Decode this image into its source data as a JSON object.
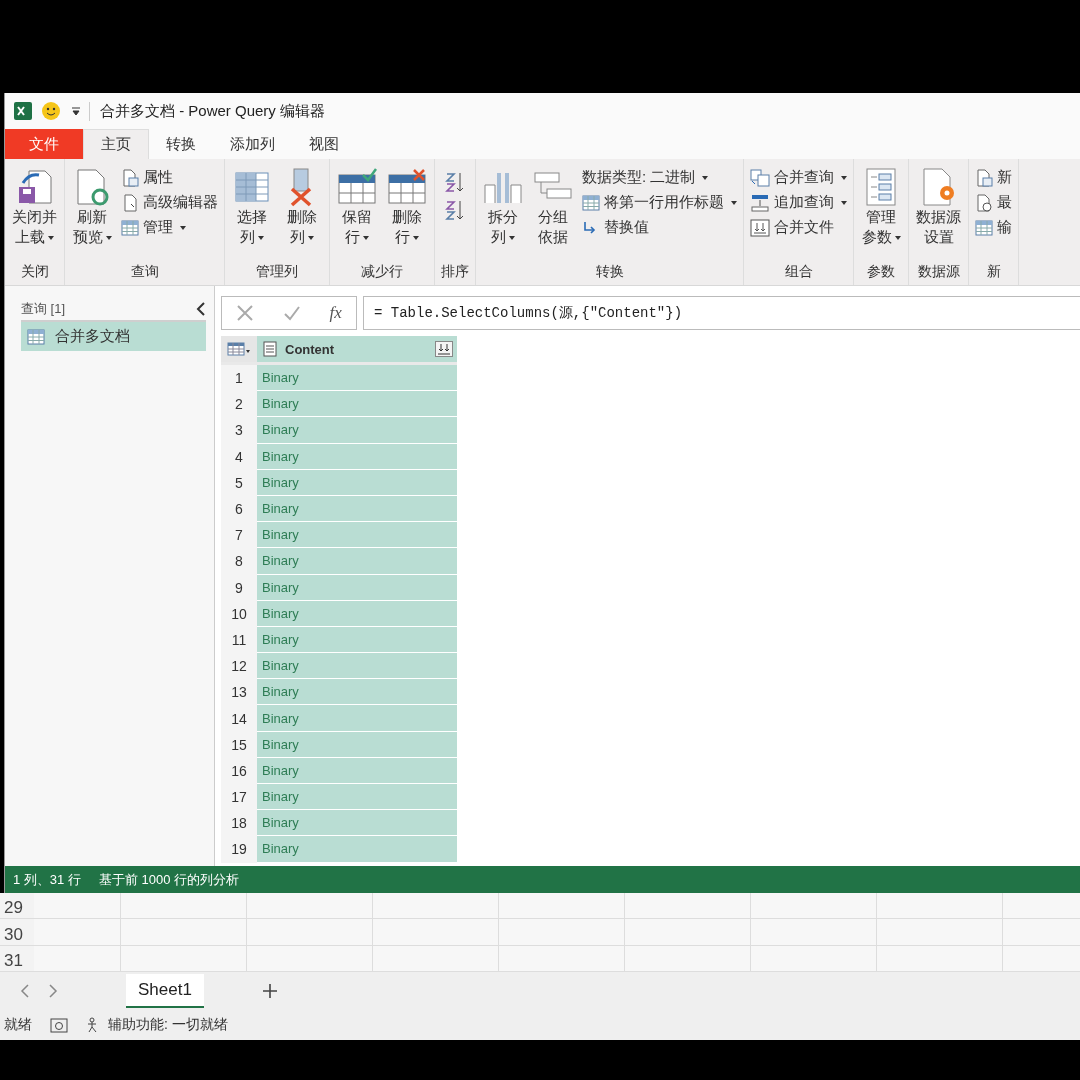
{
  "window": {
    "title": "合并多文档 - Power Query 编辑器"
  },
  "tabs": [
    {
      "label": "文件",
      "kind": "file",
      "selected": false
    },
    {
      "label": "主页",
      "kind": "tab",
      "selected": true
    },
    {
      "label": "转换",
      "kind": "tab",
      "selected": false
    },
    {
      "label": "添加列",
      "kind": "tab",
      "selected": false
    },
    {
      "label": "视图",
      "kind": "tab",
      "selected": false
    }
  ],
  "ribbon": {
    "groups": [
      {
        "label": "关闭",
        "items": [
          {
            "kind": "large",
            "lines": [
              "关闭并",
              "上载"
            ],
            "dropdown": true
          }
        ]
      },
      {
        "label": "查询",
        "items": [
          {
            "kind": "large",
            "lines": [
              "刷新",
              "预览"
            ],
            "dropdown": true
          },
          {
            "kind": "stack",
            "entries": [
              {
                "label": "属性",
                "dropdown": false
              },
              {
                "label": "高级编辑器",
                "dropdown": false
              },
              {
                "label": "管理",
                "dropdown": true
              }
            ]
          }
        ]
      },
      {
        "label": "管理列",
        "items": [
          {
            "kind": "large",
            "lines": [
              "选择",
              "列"
            ],
            "dropdown": true
          },
          {
            "kind": "large",
            "lines": [
              "删除",
              "列"
            ],
            "dropdown": true
          }
        ]
      },
      {
        "label": "减少行",
        "items": [
          {
            "kind": "large",
            "lines": [
              "保留",
              "行"
            ],
            "dropdown": true
          },
          {
            "kind": "large",
            "lines": [
              "删除",
              "行"
            ],
            "dropdown": true
          }
        ]
      },
      {
        "label": "排序",
        "items": [
          {
            "kind": "sort"
          }
        ]
      },
      {
        "label": "转换",
        "items": [
          {
            "kind": "large",
            "lines": [
              "拆分",
              "列"
            ],
            "dropdown": true
          },
          {
            "kind": "large",
            "lines": [
              "分组",
              "依据"
            ],
            "dropdown": false
          },
          {
            "kind": "stack",
            "entries": [
              {
                "label": "数据类型: 二进制",
                "dropdown": true
              },
              {
                "label": "将第一行用作标题",
                "dropdown": true
              },
              {
                "label": "替换值",
                "dropdown": false
              }
            ]
          }
        ]
      },
      {
        "label": "组合",
        "items": [
          {
            "kind": "stack",
            "entries": [
              {
                "label": "合并查询",
                "dropdown": true
              },
              {
                "label": "追加查询",
                "dropdown": true
              },
              {
                "label": "合并文件",
                "dropdown": false
              }
            ]
          }
        ]
      },
      {
        "label": "参数",
        "items": [
          {
            "kind": "large",
            "lines": [
              "管理",
              "参数"
            ],
            "dropdown": true
          }
        ]
      },
      {
        "label": "数据源",
        "items": [
          {
            "kind": "large",
            "lines": [
              "数据源",
              "设置"
            ],
            "dropdown": false
          }
        ]
      },
      {
        "label": "新",
        "items": [
          {
            "kind": "stack",
            "entries": [
              {
                "label": "新",
                "dropdown": false
              },
              {
                "label": "最",
                "dropdown": false
              },
              {
                "label": "输",
                "dropdown": false
              }
            ]
          }
        ]
      }
    ]
  },
  "queries": {
    "header": "查询 [1]",
    "items": [
      {
        "label": "合并多文档",
        "selected": true
      }
    ]
  },
  "formula_bar": {
    "fx": "fx",
    "formula": "= Table.SelectColumns(源,{\"Content\"})"
  },
  "table": {
    "columns": [
      {
        "label": "Content"
      }
    ],
    "rows": [
      {
        "index": "1",
        "value": "Binary"
      },
      {
        "index": "2",
        "value": "Binary"
      },
      {
        "index": "3",
        "value": "Binary"
      },
      {
        "index": "4",
        "value": "Binary"
      },
      {
        "index": "5",
        "value": "Binary"
      },
      {
        "index": "6",
        "value": "Binary"
      },
      {
        "index": "7",
        "value": "Binary"
      },
      {
        "index": "8",
        "value": "Binary"
      },
      {
        "index": "9",
        "value": "Binary"
      },
      {
        "index": "10",
        "value": "Binary"
      },
      {
        "index": "11",
        "value": "Binary"
      },
      {
        "index": "12",
        "value": "Binary"
      },
      {
        "index": "13",
        "value": "Binary"
      },
      {
        "index": "14",
        "value": "Binary"
      },
      {
        "index": "15",
        "value": "Binary"
      },
      {
        "index": "16",
        "value": "Binary"
      },
      {
        "index": "17",
        "value": "Binary"
      },
      {
        "index": "18",
        "value": "Binary"
      },
      {
        "index": "19",
        "value": "Binary"
      }
    ]
  },
  "status_bar": {
    "items": [
      "1 列、31 行",
      "基于前 1000 行的列分析"
    ]
  },
  "excel": {
    "row_numbers": [
      "29",
      "30",
      "31"
    ],
    "sheets": [
      {
        "label": "Sheet1",
        "selected": true
      }
    ],
    "status": {
      "ready": "就绪",
      "accessibility": "辅助功能: 一切就绪"
    }
  }
}
